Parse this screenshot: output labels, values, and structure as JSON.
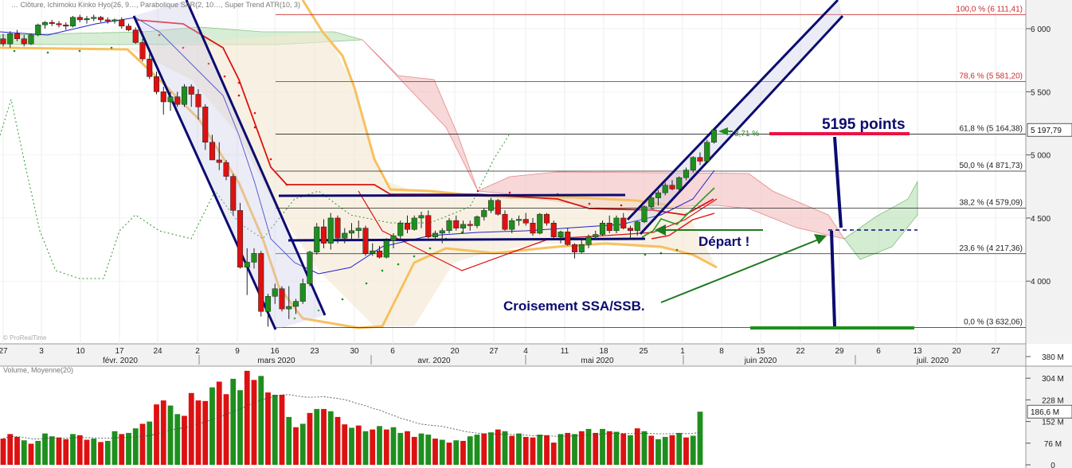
{
  "chart_data": {
    "type": "candlestick",
    "price_axis": {
      "range": [
        3450,
        6250
      ],
      "ticks": [
        {
          "value": 6000,
          "label": "6 000"
        },
        {
          "value": 5500,
          "label": "5 500"
        },
        {
          "value": 5000,
          "label": "5 000"
        },
        {
          "value": 4500,
          "label": "4 500"
        },
        {
          "value": 4000,
          "label": "4 000"
        }
      ],
      "last_price_label": "5 197,79",
      "last_price": 5197.79
    },
    "volume_axis": {
      "range": [
        0,
        400
      ],
      "ticks": [
        {
          "value": 380,
          "label": "380 M"
        },
        {
          "value": 304,
          "label": "304 M"
        },
        {
          "value": 228,
          "label": "228 M"
        },
        {
          "value": 152,
          "label": "152 M"
        },
        {
          "value": 76,
          "label": "76 M"
        },
        {
          "value": 0,
          "label": "0"
        }
      ],
      "last_volume_label": "186,6 M",
      "last_volume": 186.6
    },
    "fibonacci": [
      {
        "label": "100,0 % (6 111,41)",
        "price": 6111.41,
        "color": "#cc2a2a"
      },
      {
        "label": "78,6 % (5 581,20)",
        "price": 5581.2,
        "color": "#cc2a2a"
      },
      {
        "label": "61,8 % (5 164,38)",
        "price": 5164.38,
        "color": "#222222"
      },
      {
        "label": "50,0 % (4 871,73)",
        "price": 4871.73,
        "color": "#222222"
      },
      {
        "label": "38,2 % (4 579,09)",
        "price": 4579.09,
        "color": "#222222"
      },
      {
        "label": "23,6 % (4 217,36)",
        "price": 4217.36,
        "color": "#222222"
      },
      {
        "label": "0,0 % (3 632,06)",
        "price": 3632.06,
        "color": "#222222"
      }
    ],
    "x_day_labels": [
      "27",
      "3",
      "10",
      "17",
      "24",
      "2",
      "9",
      "16",
      "23",
      "30",
      "6",
      "20",
      "27",
      "4",
      "11",
      "18",
      "25",
      "1",
      "8",
      "15",
      "22",
      "29",
      "6",
      "13",
      "20",
      "27"
    ],
    "x_month_labels": [
      "févr. 2020",
      "mars 2020",
      "avr. 2020",
      "mai 2020",
      "juin 2020",
      "juil. 2020"
    ],
    "legend_text": "… Clôture, Ichimoku Kinko Hyo(26, 9…, Parabolique SAR(2, 10…, Super Trend ATR(10, 3)",
    "volume_legend_text": "Volume, Moyenne(20)",
    "copyright": "© ProRealTime",
    "annotations": {
      "points_label": "5195 points",
      "depart_label": "Départ !",
      "croisement_label": "Croisement SSA/SSB.",
      "pct_label": "3,71 %"
    },
    "candles_ohlc": [
      [
        5920,
        5960,
        5860,
        5880
      ],
      [
        5880,
        5980,
        5850,
        5960
      ],
      [
        5960,
        5990,
        5900,
        5920
      ],
      [
        5920,
        5950,
        5860,
        5880
      ],
      [
        5880,
        5960,
        5870,
        5950
      ],
      [
        5950,
        6040,
        5940,
        6030
      ],
      [
        6030,
        6060,
        6000,
        6050
      ],
      [
        6050,
        6070,
        6020,
        6040
      ],
      [
        6040,
        6060,
        6010,
        6030
      ],
      [
        6030,
        6050,
        5990,
        6020
      ],
      [
        6020,
        6100,
        6010,
        6090
      ],
      [
        6090,
        6110,
        6050,
        6070
      ],
      [
        6070,
        6100,
        6040,
        6080
      ],
      [
        6080,
        6111,
        6060,
        6090
      ],
      [
        6090,
        6100,
        6050,
        6070
      ],
      [
        6070,
        6090,
        6040,
        6060
      ],
      [
        6060,
        6080,
        6040,
        6070
      ],
      [
        6070,
        6090,
        6000,
        6020
      ],
      [
        6020,
        6040,
        5980,
        5990
      ],
      [
        5990,
        6010,
        5880,
        5890
      ],
      [
        5890,
        5920,
        5740,
        5760
      ],
      [
        5760,
        5800,
        5600,
        5620
      ],
      [
        5620,
        5660,
        5480,
        5500
      ],
      [
        5500,
        5540,
        5320,
        5420
      ],
      [
        5420,
        5500,
        5350,
        5460
      ],
      [
        5460,
        5500,
        5380,
        5400
      ],
      [
        5400,
        5560,
        5380,
        5540
      ],
      [
        5540,
        5560,
        5380,
        5480
      ],
      [
        5480,
        5520,
        5280,
        5380
      ],
      [
        5380,
        5400,
        5040,
        5100
      ],
      [
        5100,
        5160,
        4980,
        4960
      ],
      [
        4960,
        5100,
        4880,
        4940
      ],
      [
        4940,
        4960,
        4800,
        4830
      ],
      [
        4830,
        4850,
        4520,
        4560
      ],
      [
        4560,
        4620,
        4100,
        4110
      ],
      [
        4110,
        4260,
        3890,
        4150
      ],
      [
        4150,
        4260,
        4100,
        4220
      ],
      [
        4220,
        4240,
        3720,
        3760
      ],
      [
        3760,
        3900,
        3640,
        3880
      ],
      [
        3880,
        3980,
        3820,
        3940
      ],
      [
        3940,
        3960,
        3760,
        3780
      ],
      [
        3780,
        3960,
        3700,
        3800
      ],
      [
        3800,
        3860,
        3740,
        3840
      ],
      [
        3840,
        4020,
        3820,
        3980
      ],
      [
        3980,
        4240,
        3960,
        4230
      ],
      [
        4230,
        4460,
        4210,
        4430
      ],
      [
        4430,
        4490,
        4260,
        4300
      ],
      [
        4300,
        4540,
        4250,
        4500
      ],
      [
        4500,
        4520,
        4300,
        4340
      ],
      [
        4340,
        4420,
        4300,
        4380
      ],
      [
        4380,
        4460,
        4320,
        4400
      ],
      [
        4400,
        4480,
        4340,
        4420
      ],
      [
        4420,
        4440,
        4200,
        4220
      ],
      [
        4220,
        4300,
        4200,
        4240
      ],
      [
        4240,
        4280,
        4180,
        4190
      ],
      [
        4190,
        4340,
        4180,
        4320
      ],
      [
        4320,
        4380,
        4260,
        4360
      ],
      [
        4360,
        4480,
        4330,
        4460
      ],
      [
        4460,
        4520,
        4380,
        4410
      ],
      [
        4410,
        4520,
        4400,
        4500
      ],
      [
        4500,
        4550,
        4420,
        4520
      ],
      [
        4520,
        4560,
        4340,
        4350
      ],
      [
        4350,
        4400,
        4320,
        4380
      ],
      [
        4380,
        4420,
        4300,
        4400
      ],
      [
        4400,
        4500,
        4380,
        4480
      ],
      [
        4480,
        4520,
        4400,
        4420
      ],
      [
        4420,
        4480,
        4380,
        4450
      ],
      [
        4450,
        4480,
        4400,
        4440
      ],
      [
        4440,
        4520,
        4420,
        4510
      ],
      [
        4510,
        4580,
        4480,
        4560
      ],
      [
        4560,
        4660,
        4540,
        4640
      ],
      [
        4640,
        4650,
        4520,
        4530
      ],
      [
        4530,
        4560,
        4400,
        4410
      ],
      [
        4410,
        4500,
        4380,
        4480
      ],
      [
        4480,
        4520,
        4440,
        4490
      ],
      [
        4490,
        4540,
        4440,
        4460
      ],
      [
        4460,
        4500,
        4360,
        4380
      ],
      [
        4380,
        4540,
        4370,
        4530
      ],
      [
        4530,
        4540,
        4440,
        4460
      ],
      [
        4460,
        4480,
        4340,
        4350
      ],
      [
        4350,
        4400,
        4300,
        4390
      ],
      [
        4390,
        4420,
        4280,
        4290
      ],
      [
        4290,
        4300,
        4180,
        4230
      ],
      [
        4230,
        4340,
        4220,
        4290
      ],
      [
        4290,
        4370,
        4260,
        4350
      ],
      [
        4350,
        4400,
        4330,
        4370
      ],
      [
        4370,
        4480,
        4360,
        4460
      ],
      [
        4460,
        4520,
        4380,
        4400
      ],
      [
        4400,
        4520,
        4380,
        4500
      ],
      [
        4500,
        4540,
        4410,
        4420
      ],
      [
        4420,
        4440,
        4330,
        4400
      ],
      [
        4400,
        4480,
        4360,
        4470
      ],
      [
        4470,
        4600,
        4460,
        4590
      ],
      [
        4590,
        4680,
        4570,
        4660
      ],
      [
        4660,
        4720,
        4600,
        4700
      ],
      [
        4700,
        4780,
        4680,
        4760
      ],
      [
        4760,
        4800,
        4720,
        4730
      ],
      [
        4730,
        4830,
        4710,
        4820
      ],
      [
        4820,
        4900,
        4800,
        4880
      ],
      [
        4880,
        4990,
        4860,
        4980
      ],
      [
        4980,
        5020,
        4920,
        4950
      ],
      [
        4950,
        5120,
        4940,
        5100
      ],
      [
        5100,
        5200,
        5090,
        5197.79
      ]
    ],
    "volumes_M": [
      [
        92,
        0
      ],
      [
        108,
        0
      ],
      [
        98,
        0
      ],
      [
        86,
        1
      ],
      [
        74,
        0
      ],
      [
        84,
        1
      ],
      [
        110,
        1
      ],
      [
        100,
        1
      ],
      [
        96,
        0
      ],
      [
        90,
        0
      ],
      [
        108,
        1
      ],
      [
        104,
        0
      ],
      [
        88,
        0
      ],
      [
        92,
        1
      ],
      [
        80,
        0
      ],
      [
        84,
        1
      ],
      [
        118,
        1
      ],
      [
        108,
        0
      ],
      [
        112,
        1
      ],
      [
        128,
        1
      ],
      [
        144,
        0
      ],
      [
        152,
        1
      ],
      [
        212,
        0
      ],
      [
        226,
        0
      ],
      [
        208,
        1
      ],
      [
        178,
        1
      ],
      [
        172,
        0
      ],
      [
        252,
        0
      ],
      [
        226,
        0
      ],
      [
        224,
        0
      ],
      [
        272,
        1
      ],
      [
        292,
        0
      ],
      [
        248,
        0
      ],
      [
        302,
        1
      ],
      [
        262,
        1
      ],
      [
        330,
        0
      ],
      [
        298,
        0
      ],
      [
        312,
        1
      ],
      [
        254,
        0
      ],
      [
        246,
        1
      ],
      [
        246,
        0
      ],
      [
        168,
        1
      ],
      [
        132,
        0
      ],
      [
        144,
        1
      ],
      [
        182,
        0
      ],
      [
        196,
        1
      ],
      [
        196,
        0
      ],
      [
        188,
        1
      ],
      [
        168,
        0
      ],
      [
        142,
        0
      ],
      [
        130,
        1
      ],
      [
        138,
        0
      ],
      [
        118,
        1
      ],
      [
        124,
        0
      ],
      [
        136,
        1
      ],
      [
        124,
        0
      ],
      [
        132,
        1
      ],
      [
        112,
        1
      ],
      [
        118,
        0
      ],
      [
        98,
        0
      ],
      [
        110,
        1
      ],
      [
        106,
        1
      ],
      [
        92,
        0
      ],
      [
        88,
        1
      ],
      [
        78,
        0
      ],
      [
        86,
        1
      ],
      [
        84,
        0
      ],
      [
        100,
        1
      ],
      [
        106,
        1
      ],
      [
        110,
        0
      ],
      [
        114,
        1
      ],
      [
        124,
        0
      ],
      [
        118,
        1
      ],
      [
        102,
        0
      ],
      [
        110,
        1
      ],
      [
        98,
        0
      ],
      [
        96,
        0
      ],
      [
        106,
        1
      ],
      [
        104,
        0
      ],
      [
        78,
        0
      ],
      [
        108,
        1
      ],
      [
        112,
        0
      ],
      [
        108,
        1
      ],
      [
        118,
        0
      ],
      [
        126,
        1
      ],
      [
        112,
        0
      ],
      [
        126,
        1
      ],
      [
        118,
        0
      ],
      [
        116,
        1
      ],
      [
        110,
        0
      ],
      [
        104,
        1
      ],
      [
        128,
        0
      ],
      [
        118,
        1
      ],
      [
        102,
        0
      ],
      [
        90,
        1
      ],
      [
        98,
        1
      ],
      [
        104,
        0
      ],
      [
        112,
        1
      ],
      [
        96,
        0
      ],
      [
        102,
        1
      ],
      [
        186.6,
        1
      ]
    ]
  },
  "colors": {
    "up": "#1e8f1e",
    "down": "#dd1111",
    "fib_red": "#cc2a2a",
    "cloud_green": "#b8e0b4",
    "cloud_red": "#f2b8b8",
    "navy": "#0b0b70",
    "bollinger": "#f8c060"
  }
}
